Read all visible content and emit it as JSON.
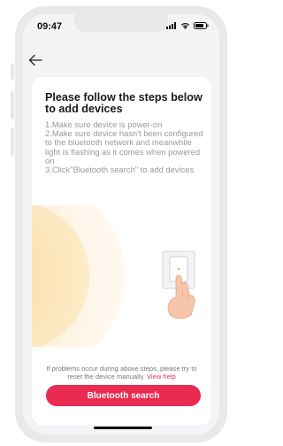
{
  "status_bar": {
    "time": "09:47",
    "icons": [
      "signal-icon",
      "wifi-icon",
      "battery-icon"
    ]
  },
  "nav": {
    "back_icon": "back-arrow-icon"
  },
  "instructions": {
    "title": "Please follow the steps below to add devices",
    "steps": [
      "1.Make sure device is power-on",
      "2.Make sure device hasn't been configured to the bluetooth network and meanwhile light is flashing as it comes when powered on",
      "3.Click\"Bluetooth search\" to add devices"
    ]
  },
  "illustration": {
    "name": "light-switch-hand-illustration"
  },
  "help": {
    "text": "If problems occur during above steps, please try to reset the device manually.",
    "link": "View help"
  },
  "actions": {
    "bluetooth_search": "Bluetooth search"
  },
  "colors": {
    "accent": "#ea2a50",
    "link": "#e63454",
    "title_text": "#1a1a1a",
    "body_text": "#9a9a9a"
  }
}
